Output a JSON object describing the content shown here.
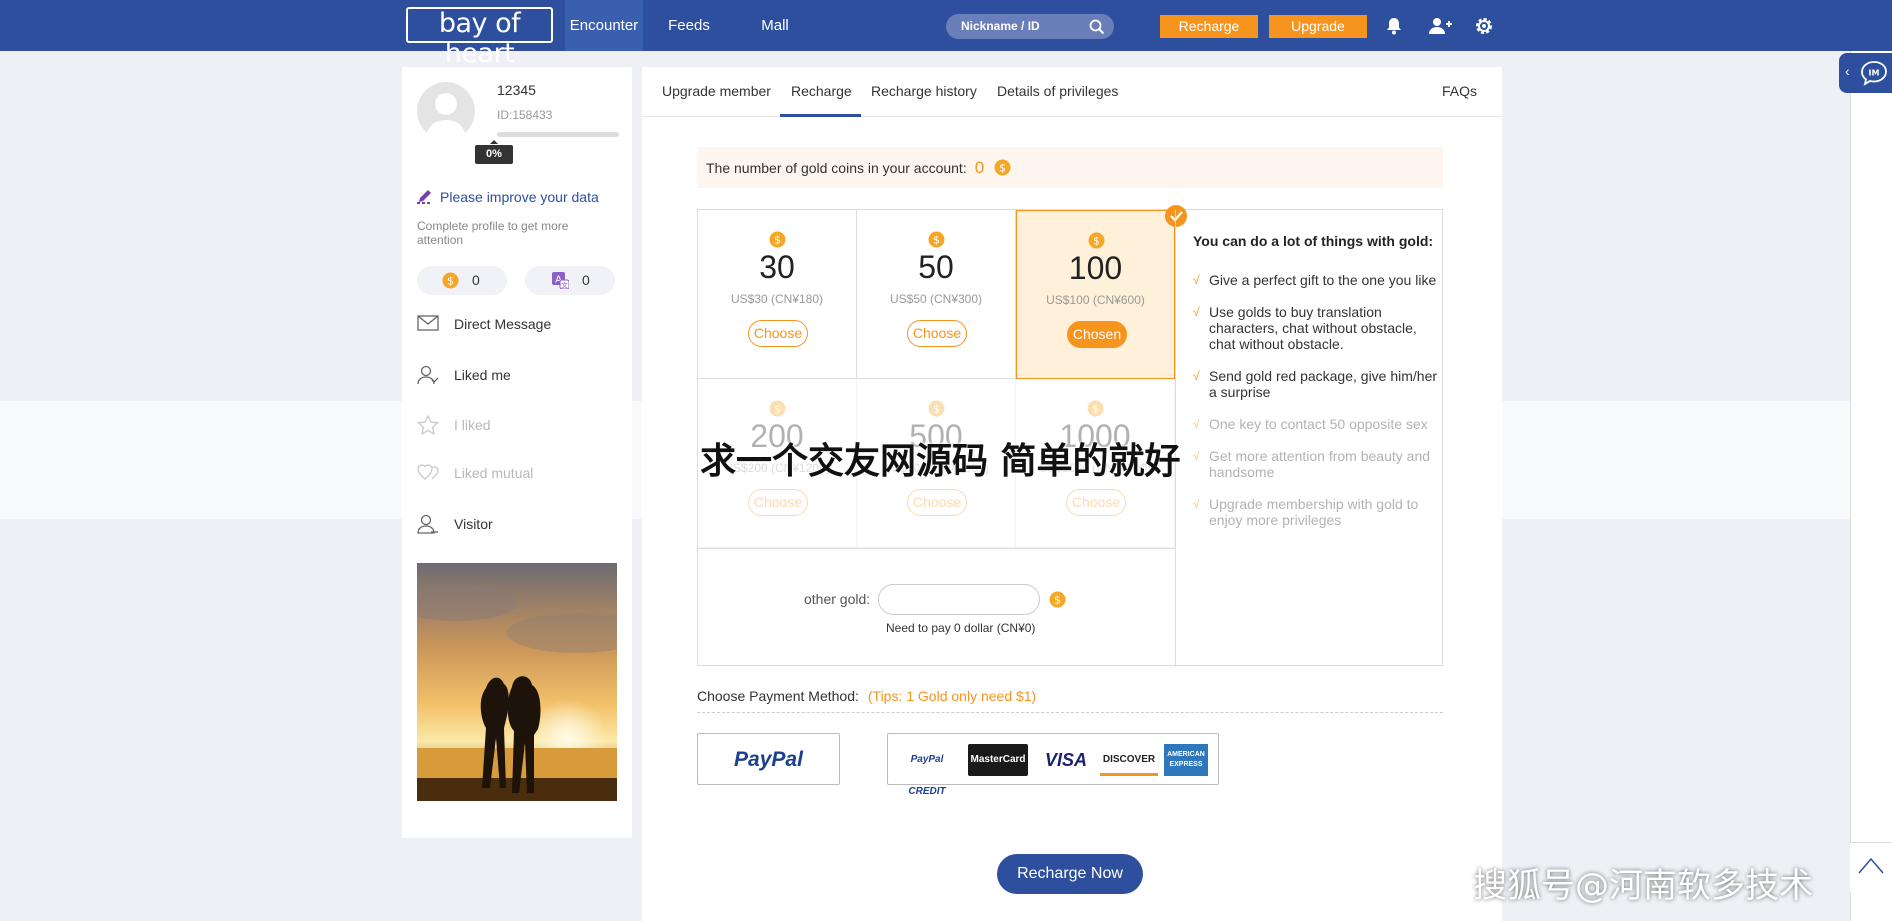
{
  "header": {
    "logo": "bay of heart",
    "nav": [
      "Encounter",
      "Feeds",
      "Mall"
    ],
    "search_placeholder": "Nickname / ID",
    "recharge": "Recharge",
    "upgrade": "Upgrade"
  },
  "profile": {
    "username": "12345",
    "user_id": "ID:158433",
    "progress_label": "0%",
    "progress_fraction": 0,
    "improve": "Please improve your data",
    "complete_hint": "Complete profile to get more attention",
    "gold_count": "0",
    "translate_count": "0",
    "menu": [
      "Direct Message",
      "Liked me",
      "I liked",
      "Liked mutual",
      "Visitor"
    ]
  },
  "tabs": [
    "Upgrade member",
    "Recharge",
    "Recharge history",
    "Details of privileges"
  ],
  "faqs": "FAQs",
  "account": {
    "label": "The number of gold coins in your account:",
    "value": "0"
  },
  "packages": [
    {
      "amount": "30",
      "price": "US$30 (CN¥180)",
      "button": "Choose"
    },
    {
      "amount": "50",
      "price": "US$50 (CN¥300)",
      "button": "Choose"
    },
    {
      "amount": "100",
      "price": "US$100 (CN¥600)",
      "button": "Chosen"
    },
    {
      "amount": "200",
      "price": "US$200 (CN¥1200)",
      "button": "Choose"
    },
    {
      "amount": "500",
      "price": "US$500 (CN¥3000)",
      "button": "Choose"
    },
    {
      "amount": "1000",
      "price": "US$1000 (CN¥6000)",
      "button": "Choose"
    }
  ],
  "benefits": {
    "title": "You can do a lot of things with gold:",
    "items": [
      "Give a perfect gift to the one you like",
      "Use golds to buy translation characters, chat without obstacle, chat without obstacle.",
      "Send gold red package, give him/her a surprise",
      "One key to contact 50 opposite sex",
      "Get more attention from beauty and handsome",
      "Upgrade membership with gold to enjoy more privileges"
    ]
  },
  "other_gold": {
    "label": "other gold:",
    "need": "Need to pay 0 dollar (CN¥0)"
  },
  "payment": {
    "label": "Choose Payment Method:",
    "tip": "(Tips: 1 Gold only need $1)",
    "paypal": "PayPal",
    "cards": [
      "PayPal CREDIT",
      "MasterCard",
      "VISA",
      "DISCOVER",
      "AMERICAN EXPRESS"
    ]
  },
  "recharge_now": "Recharge Now",
  "overlay_title": "求一个交友网源码 简单的就好",
  "watermark": "搜狐号@河南软多技术",
  "im_label": "IM",
  "colors": {
    "brand": "#2d4f9e",
    "accent": "#f7941d"
  }
}
